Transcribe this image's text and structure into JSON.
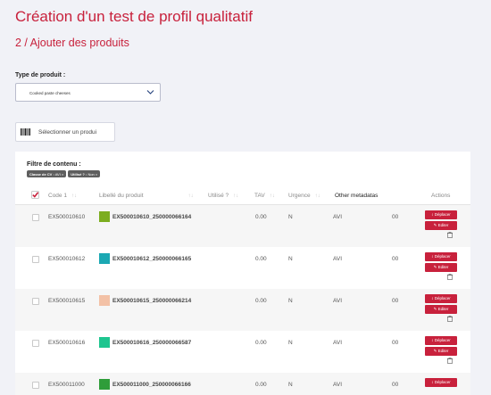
{
  "page": {
    "title": "Création d'un test de profil qualitatif",
    "subtitle": "2 / Ajouter des produits"
  },
  "product_type": {
    "label": "Type de produit :",
    "value": "Cooked paste cheeses"
  },
  "scan_button": {
    "label": "Sélectionner un produi"
  },
  "filter": {
    "title": "Filtre de contenu :",
    "chips": [
      {
        "key": "Classe de CV :",
        "value": "AVI ×"
      },
      {
        "key": "Utilisé ? :",
        "value": "Non ×"
      }
    ]
  },
  "table": {
    "headers": {
      "code": "Code 1",
      "label": "Libellé du produit",
      "used": "Utilisé ?",
      "tav": "TAV",
      "urgency": "Urgence",
      "meta": "Other metadatas",
      "actions": "Actions"
    },
    "sort_glyph": "↑↓",
    "move_label": "↕ Déplacer",
    "edit_label": "✎ Editer",
    "rows": [
      {
        "code": "EX500010610",
        "label": "EX500010610_250000066164",
        "tav": "0.00",
        "urgency": "N",
        "meta1": "AVI",
        "meta2": "00"
      },
      {
        "code": "EX500010612",
        "label": "EX500010612_250000066165",
        "tav": "0.00",
        "urgency": "N",
        "meta1": "AVI",
        "meta2": "00"
      },
      {
        "code": "EX500010615",
        "label": "EX500010615_250000066214",
        "tav": "0.00",
        "urgency": "N",
        "meta1": "AVI",
        "meta2": "00"
      },
      {
        "code": "EX500010616",
        "label": "EX500010616_250000066587",
        "tav": "0.00",
        "urgency": "N",
        "meta1": "AVI",
        "meta2": "00"
      },
      {
        "code": "EX500011000",
        "label": "EX500011000_250000066166",
        "tav": "0.00",
        "urgency": "N",
        "meta1": "AVI",
        "meta2": "00"
      }
    ]
  },
  "colors": {
    "accent": "#c8213c",
    "swatches": [
      "#7cad1f",
      "#1ba8b3",
      "#f3c1a6",
      "#1ec58f",
      "#2f9d3a"
    ]
  },
  "icons": {
    "barcode": "barcode-icon",
    "chevron": "chevron-down-icon",
    "trash": "trash-icon"
  }
}
